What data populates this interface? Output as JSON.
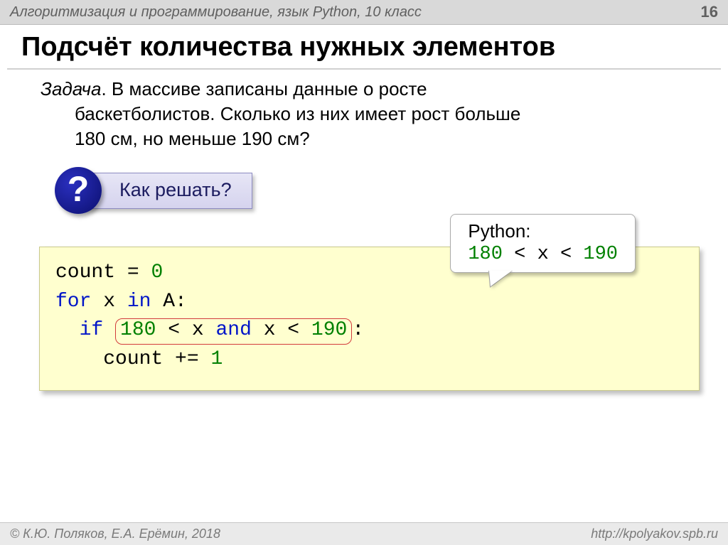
{
  "header": {
    "course": "Алгоритмизация и программирование, язык Python, 10 класс",
    "page": "16"
  },
  "title": "Подсчёт количества нужных элементов",
  "task": {
    "label": "Задача",
    "line1_rest": ". В массиве записаны данные о росте",
    "line2": "баскетболистов. Сколько из них имеет рост больше",
    "line3": "180 см, но меньше 190 см?"
  },
  "hint": {
    "badge": "?",
    "text": "Как решать?"
  },
  "code": {
    "l1_a": "count",
    "l1_b": " = ",
    "l1_c": "0",
    "l2_a": "for",
    "l2_b": " x ",
    "l2_c": "in",
    "l2_d": " A:",
    "l3_a": "  ",
    "l3_b": "if",
    "l3_c": " ",
    "cond_1": "180",
    "cond_2": " < x ",
    "cond_3": "and",
    "cond_4": " x < ",
    "cond_5": "190",
    "l3_end": ":",
    "l4_a": "    count += ",
    "l4_b": "1"
  },
  "callout": {
    "lang": "Python:",
    "expr_1": "180",
    "expr_2": " < x < ",
    "expr_3": "190"
  },
  "footer": {
    "left": "© К.Ю. Поляков, Е.А. Ерёмин, 2018",
    "right": "http://kpolyakov.spb.ru"
  }
}
